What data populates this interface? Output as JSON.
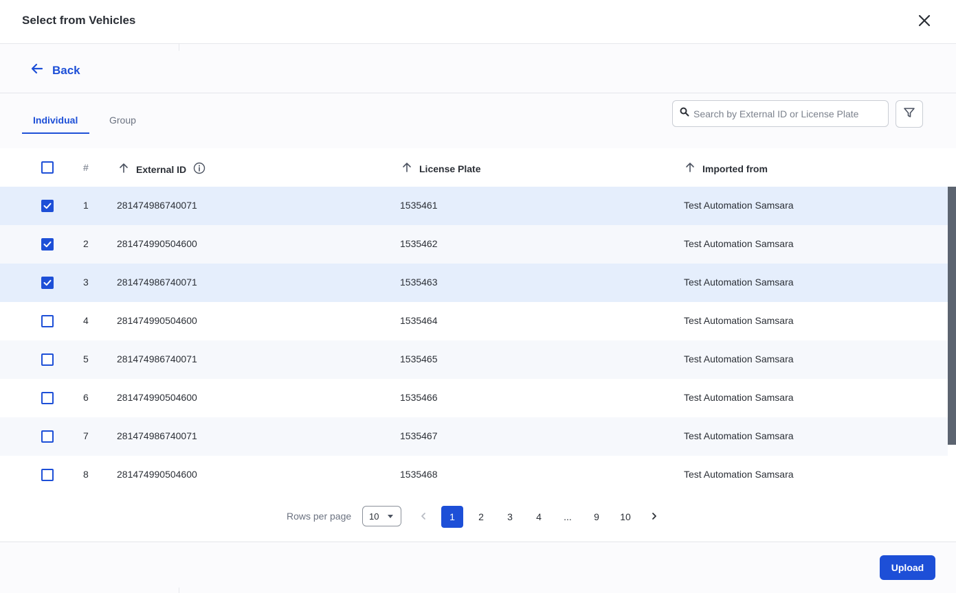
{
  "header": {
    "title": "Select from Vehicles"
  },
  "back": {
    "label": "Back"
  },
  "tabs": [
    {
      "label": "Individual",
      "active": true
    },
    {
      "label": "Group",
      "active": false
    }
  ],
  "search": {
    "placeholder": "Search by External ID or License Plate",
    "value": ""
  },
  "table": {
    "columns": {
      "num": "#",
      "external_id": "External ID",
      "license_plate": "License Plate",
      "imported_from": "Imported from"
    },
    "rows": [
      {
        "index": "1",
        "external_id": "281474986740071",
        "license_plate": "1535461",
        "imported_from": "Test Automation Samsara",
        "checked": true
      },
      {
        "index": "2",
        "external_id": "281474990504600",
        "license_plate": "1535462",
        "imported_from": "Test Automation Samsara",
        "checked": true
      },
      {
        "index": "3",
        "external_id": "281474986740071",
        "license_plate": "1535463",
        "imported_from": "Test Automation Samsara",
        "checked": true
      },
      {
        "index": "4",
        "external_id": "281474990504600",
        "license_plate": "1535464",
        "imported_from": "Test Automation Samsara",
        "checked": false
      },
      {
        "index": "5",
        "external_id": "281474986740071",
        "license_plate": "1535465",
        "imported_from": "Test Automation Samsara",
        "checked": false
      },
      {
        "index": "6",
        "external_id": "281474990504600",
        "license_plate": "1535466",
        "imported_from": "Test Automation Samsara",
        "checked": false
      },
      {
        "index": "7",
        "external_id": "281474986740071",
        "license_plate": "1535467",
        "imported_from": "Test Automation Samsara",
        "checked": false
      },
      {
        "index": "8",
        "external_id": "281474990504600",
        "license_plate": "1535468",
        "imported_from": "Test Automation Samsara",
        "checked": false
      }
    ]
  },
  "pagination": {
    "rows_per_page_label": "Rows per page",
    "rows_per_page_value": "10",
    "pages": [
      "1",
      "2",
      "3",
      "4",
      "...",
      "9",
      "10"
    ],
    "current_page": "1"
  },
  "footer": {
    "upload_label": "Upload"
  },
  "colors": {
    "accent": "#1d4fd7",
    "selected_row": "#e5eefc"
  }
}
